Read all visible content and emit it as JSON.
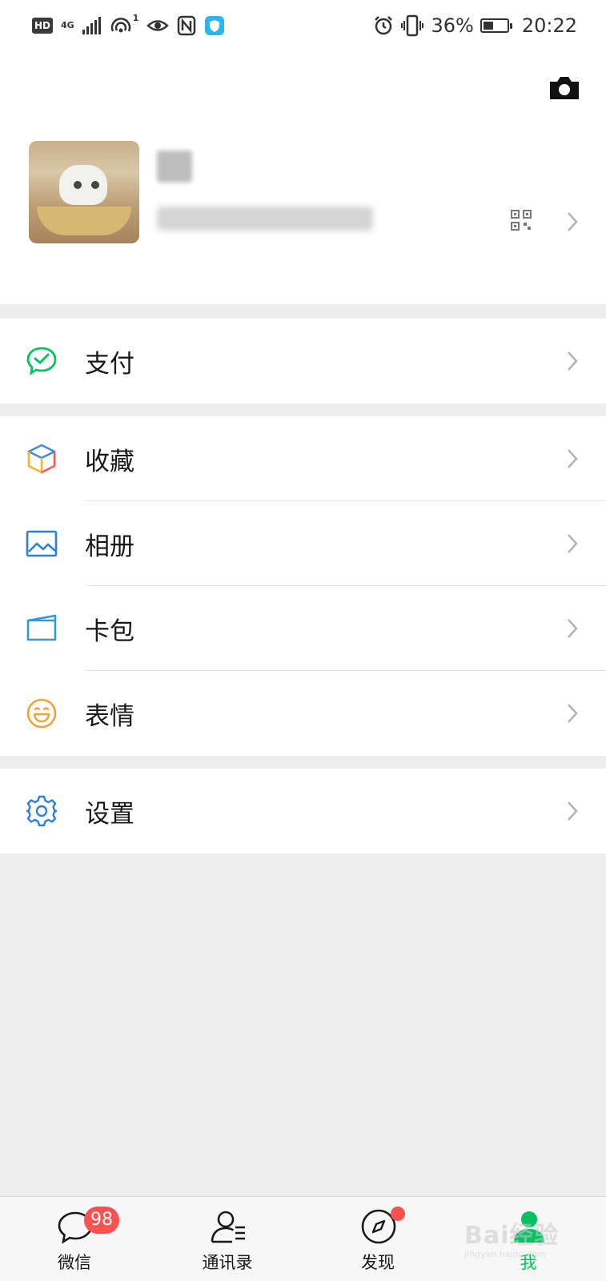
{
  "status_bar": {
    "hd": "HD",
    "network": "4G",
    "hotspot_count": "1",
    "battery": "36%",
    "time": "20:22"
  },
  "profile": {
    "camera_icon": "camera-icon",
    "qr_icon": "qr-code-icon"
  },
  "menu": {
    "pay": "支付",
    "favorites": "收藏",
    "album": "相册",
    "cards": "卡包",
    "stickers": "表情",
    "settings": "设置"
  },
  "tabs": [
    {
      "label": "微信",
      "badge": "98"
    },
    {
      "label": "通讯录"
    },
    {
      "label": "发现"
    },
    {
      "label": "我"
    }
  ],
  "colors": {
    "accent": "#07c160",
    "badge": "#fa5151",
    "background": "#ededed"
  },
  "watermark": {
    "text": "Bai经验",
    "url": "jingyan.baidu.com"
  }
}
